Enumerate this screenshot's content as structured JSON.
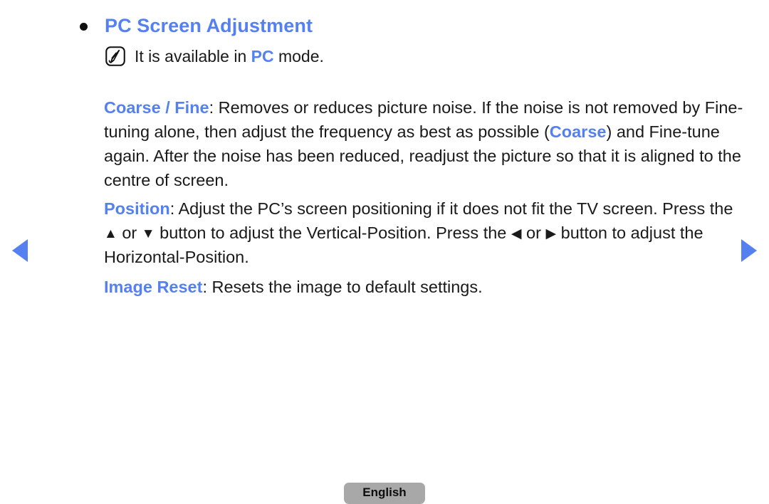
{
  "page": {
    "background_color": "#ffffff",
    "accent_color": "#5580f0",
    "text_color": "#1a1a1a"
  },
  "nav": {
    "prev_label": "◀",
    "next_label": "▶"
  },
  "heading": {
    "bullet": "•",
    "text": "PC Screen Adjustment"
  },
  "note": {
    "icon": "note-pen-icon",
    "text_before": "It is available in ",
    "keyword": "PC",
    "text_after": " mode."
  },
  "paragraphs": {
    "coarse_fine": {
      "keyword": "Coarse / Fine",
      "seg1": ": Removes or reduces picture noise. If the noise is not removed by Fine-tuning alone, then adjust the frequency as best as possible (",
      "inline_keyword": "Coarse",
      "seg2": ") and Fine-tune again. After the noise has been reduced, readjust the picture so that it is aligned to the centre of screen."
    },
    "position": {
      "keyword": "Position",
      "seg1": ": Adjust the PC’s screen positioning if it does not fit the TV screen. Press the ",
      "arrow_up": "▲",
      "seg2": " or ",
      "arrow_down": "▼",
      "seg3": " button to adjust the Vertical-Position. Press the ",
      "arrow_left": "◀",
      "seg4": " or ",
      "arrow_right": "▶",
      "seg5": " button to adjust the Horizontal-Position."
    },
    "image_reset": {
      "keyword": "Image Reset",
      "seg1": ": Resets the image to default settings."
    }
  },
  "footer": {
    "language": "English"
  }
}
